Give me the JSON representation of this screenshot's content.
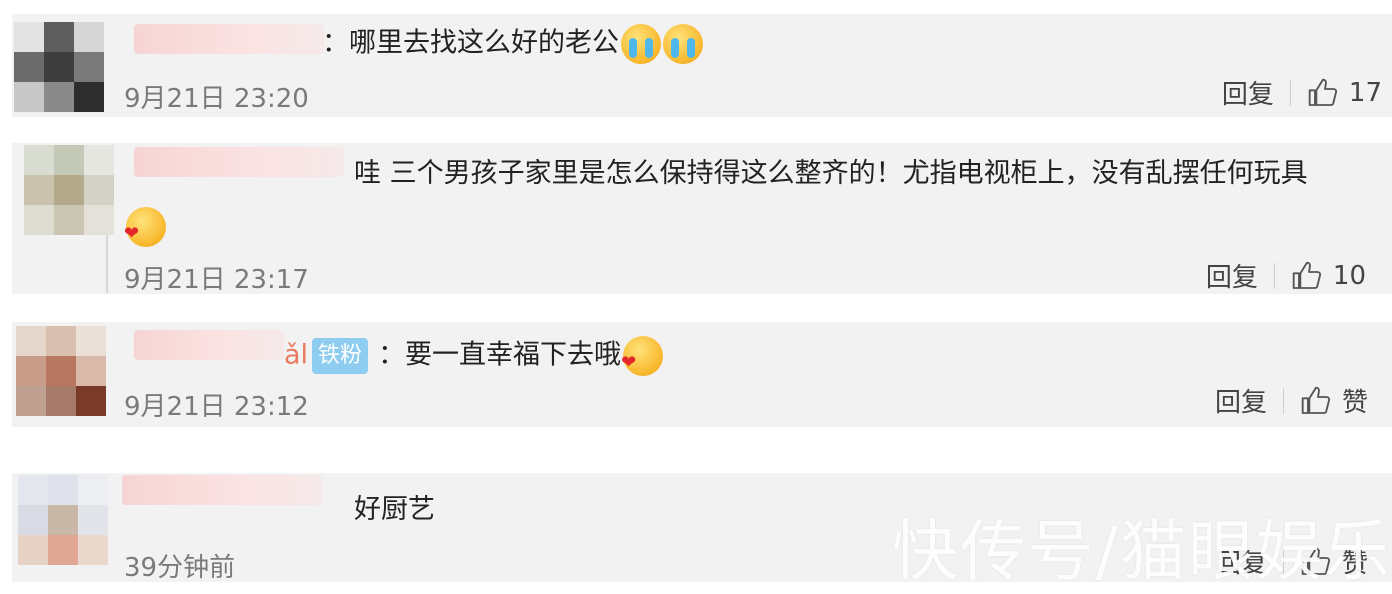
{
  "comments": [
    {
      "text": "：哪里去找这么好的老公",
      "time": "9月21日 23:20",
      "reply": "回复",
      "likes": "17",
      "emojis": [
        "cry-emoji",
        "cry-emoji"
      ]
    },
    {
      "text": "哇 三个男孩子家里是怎么保持得这么整齐的！尤指电视柜上，没有乱摆任何玩具",
      "time": "9月21日 23:17",
      "reply": "回复",
      "likes": "10",
      "emojis": [
        "love-emoji"
      ]
    },
    {
      "name_tail": "ǎl",
      "badge": "铁粉",
      "text": "：要一直幸福下去哦",
      "time": "9月21日 23:12",
      "reply": "回复",
      "likes": "赞",
      "emojis": [
        "love-emoji"
      ]
    },
    {
      "text": "好厨艺",
      "time": "39分钟前",
      "reply": "回复",
      "likes": "赞"
    }
  ],
  "watermark": "快传号/猫眼娱乐",
  "colors": {
    "row_bg": "#f2f2f2",
    "badge": "#8ecdf0",
    "time": "#7a7a7a"
  },
  "icons": [
    "thumbs-up-icon"
  ]
}
